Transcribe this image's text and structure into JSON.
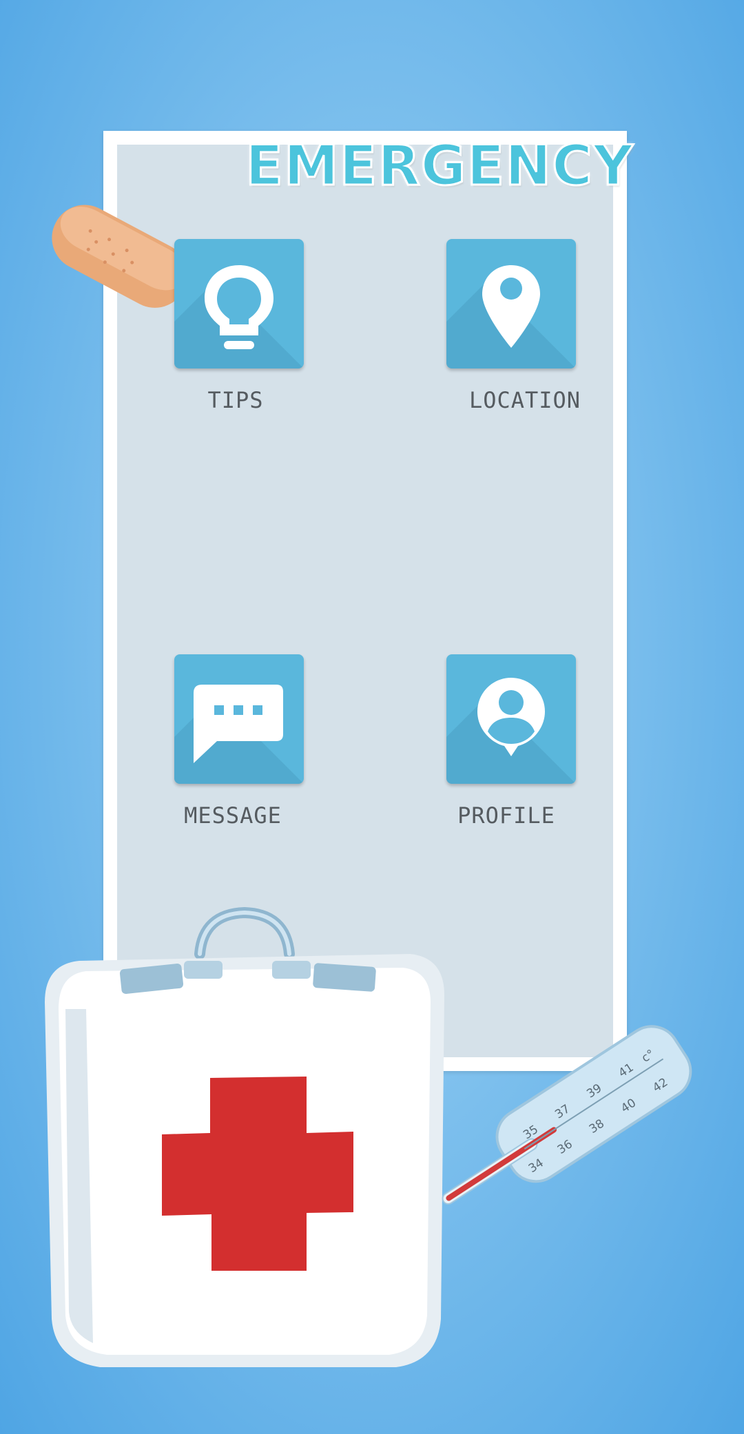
{
  "header": {
    "title": "EMERGENCY"
  },
  "menu": {
    "tips": {
      "label": "TIPS",
      "icon": "lightbulb-icon"
    },
    "location": {
      "label": "LOCATION",
      "icon": "location-pin-icon"
    },
    "message": {
      "label": "MESSAGE",
      "icon": "chat-message-icon"
    },
    "profile": {
      "label": "PROFILE",
      "icon": "user-profile-icon"
    }
  },
  "decor": {
    "thermometer_ticks": [
      "34",
      "35",
      "36",
      "37",
      "38",
      "39",
      "40",
      "41",
      "42",
      "c°"
    ]
  },
  "colors": {
    "tile": "#5ab7dc",
    "title": "#4cc4dc",
    "panel": "#d5e1e9",
    "cross": "#d32f2f"
  }
}
